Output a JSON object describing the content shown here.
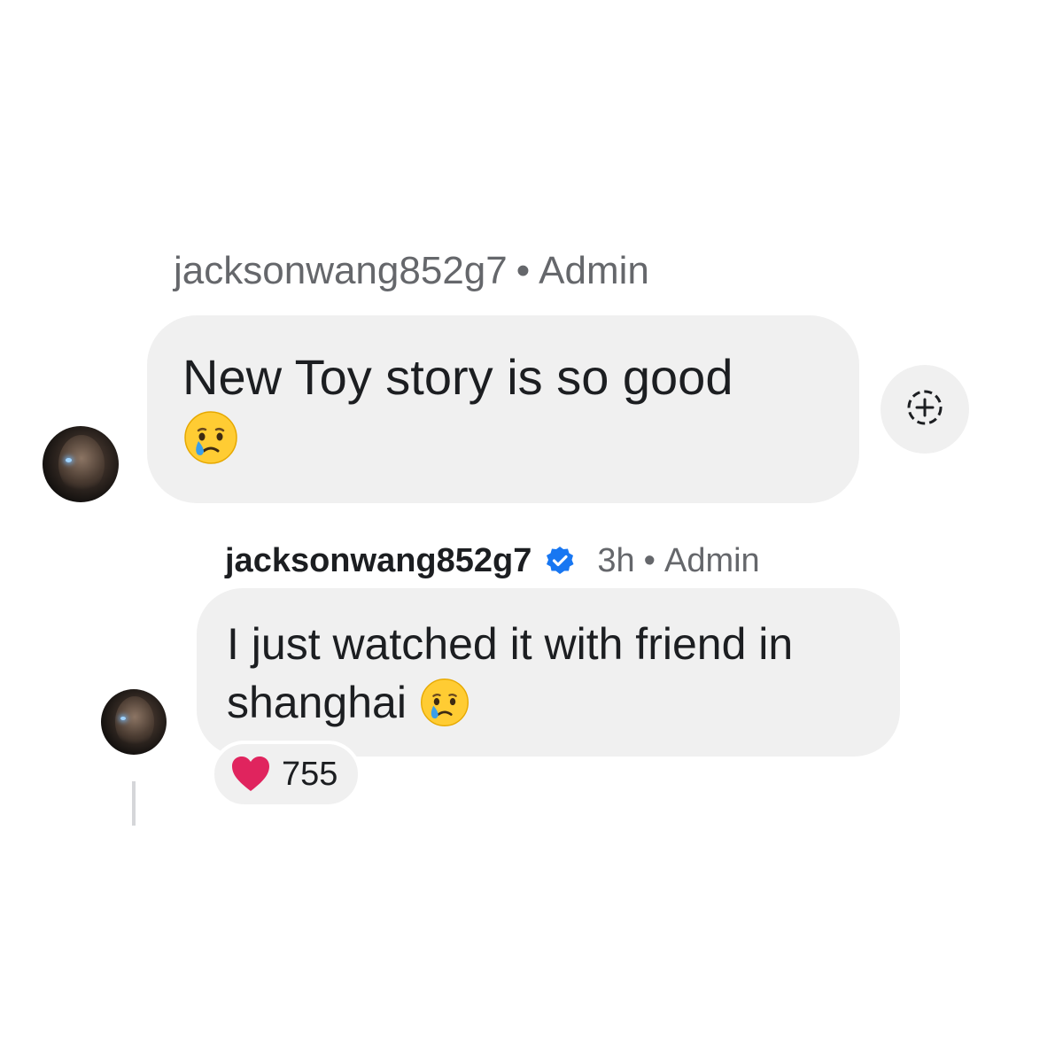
{
  "comment": {
    "username": "jacksonwang852g7",
    "separator": "•",
    "role": "Admin",
    "text": "New Toy story is so good",
    "emoji": "crying-face"
  },
  "add_reaction": {
    "icon": "add-reaction-icon"
  },
  "reply": {
    "username": "jacksonwang852g7",
    "verified_icon": "verified-badge-icon",
    "time": "3h",
    "separator": "•",
    "role": "Admin",
    "text_line1": "I just watched it with friend in",
    "text_line2": "shanghai",
    "emoji": "crying-face",
    "reaction": {
      "icon": "heart-icon",
      "count": "755"
    }
  },
  "colors": {
    "bubble": "#f0f0f0",
    "meta_text": "#65676b",
    "verified": "#1877f2",
    "heart": "#e0245e"
  }
}
